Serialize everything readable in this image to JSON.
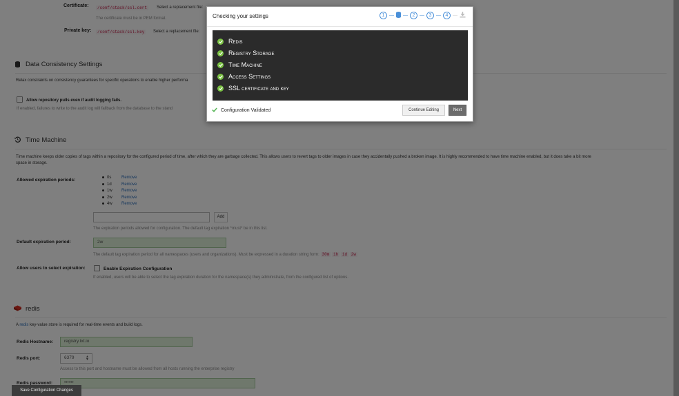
{
  "ssl": {
    "certificate_label": "Certificate:",
    "certificate_path": "/conf/stack/ssl.cert",
    "certificate_replace": "Select a replacement file:",
    "certificate_help": "The certificate must be in PEM format.",
    "key_label": "Private key:",
    "key_path": "/conf/stack/ssl.key",
    "key_replace": "Select a replacement file:"
  },
  "consistency": {
    "title": "Data Consistency Settings",
    "description": "Relax constraints on consistency guarantees for specific operations to enable higher performa",
    "checkbox_label": "Allow repository pulls even if audit logging fails.",
    "checkbox_help": "If enabled, failures to write to the audit log will fallback from the database to the stand"
  },
  "time_machine": {
    "title": "Time Machine",
    "description": "Time machine keeps older copies of tags within a repository for the configured period of time, after which they are garbage collected. This allows users to revert tags to older images in case they accidentally pushed a broken image. It is highly recommended to have time machine enabled, but it does take a bit more",
    "description_2": "space in storage.",
    "periods_label": "Allowed expiration periods:",
    "periods": [
      {
        "value": "0s",
        "action": "Remove"
      },
      {
        "value": "1d",
        "action": "Remove"
      },
      {
        "value": "1w",
        "action": "Remove"
      },
      {
        "value": "2w",
        "action": "Remove"
      },
      {
        "value": "4w",
        "action": "Remove"
      }
    ],
    "add_label": "Add",
    "periods_help": "The expiration periods allowed for configuration. The default tag expiration *must* be in this list.",
    "default_label": "Default expiration period:",
    "default_value": "2w",
    "default_help": "The default tag expiration period for all namespaces (users and organizations). Must be expressed in a duration string form:",
    "duration_examples": [
      "30m",
      "1h",
      "1d",
      "2w"
    ],
    "allow_label": "Allow users to select expiration:",
    "allow_checkbox": "Enable Expiration Configuration",
    "allow_help": "If enabled, users will be able to select the tag expiration duration for the namespace(s) they administrate, from the configured list of options."
  },
  "redis": {
    "title": "redis",
    "desc_prefix": "A ",
    "desc_link": "redis",
    "desc_suffix": " key-value store is required for real-time events and build logs.",
    "hostname_label": "Redis Hostname:",
    "hostname_value": "registry.txt.io",
    "port_label": "Redis port:",
    "port_value": "6379",
    "port_help": "Access to this port and hostname must be allowed from all hosts running the enterprise registry",
    "password_label": "Redis password:",
    "password_value": "••••••"
  },
  "save_button": "Save Configuration Changes",
  "modal": {
    "title": "Checking your settings",
    "steps": [
      "1",
      "2",
      "3",
      "4"
    ],
    "checks": [
      "Redis",
      "Registry Storage",
      "Time Machine",
      "Access Settings",
      "SSL certificate and key"
    ],
    "status": "Configuration Validated",
    "continue_label": "Continue Editing",
    "next_label": "Next"
  }
}
